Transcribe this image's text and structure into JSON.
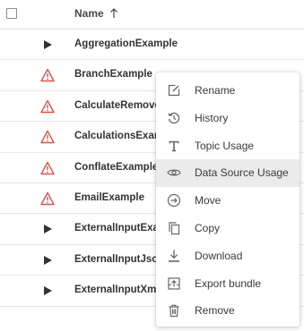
{
  "header": {
    "name_label": "Name"
  },
  "rows": [
    {
      "label": "AggregationExample",
      "status": "play"
    },
    {
      "label": "BranchExample",
      "status": "warning"
    },
    {
      "label": "CalculateRemove",
      "status": "warning"
    },
    {
      "label": "CalculationsExam",
      "status": "warning"
    },
    {
      "label": "ConflateExample",
      "status": "warning"
    },
    {
      "label": "EmailExample",
      "status": "warning"
    },
    {
      "label": "ExternalInputExa",
      "status": "play"
    },
    {
      "label": "ExternalInputJso",
      "status": "play"
    },
    {
      "label": "ExternalInputXm",
      "status": "play"
    }
  ],
  "menu": {
    "items": [
      {
        "label": "Rename",
        "icon": "rename-icon"
      },
      {
        "label": "History",
        "icon": "history-icon"
      },
      {
        "label": "Topic Usage",
        "icon": "topic-usage-icon"
      },
      {
        "label": "Data Source Usage",
        "icon": "eye-icon",
        "highlighted": true
      },
      {
        "label": "Move",
        "icon": "move-icon"
      },
      {
        "label": "Copy",
        "icon": "copy-icon"
      },
      {
        "label": "Download",
        "icon": "download-icon"
      },
      {
        "label": "Export bundle",
        "icon": "export-bundle-icon"
      },
      {
        "label": "Remove",
        "icon": "trash-icon"
      }
    ]
  },
  "colors": {
    "warning": "#d9534f",
    "icon": "#666666",
    "highlight": "#ebebeb"
  }
}
